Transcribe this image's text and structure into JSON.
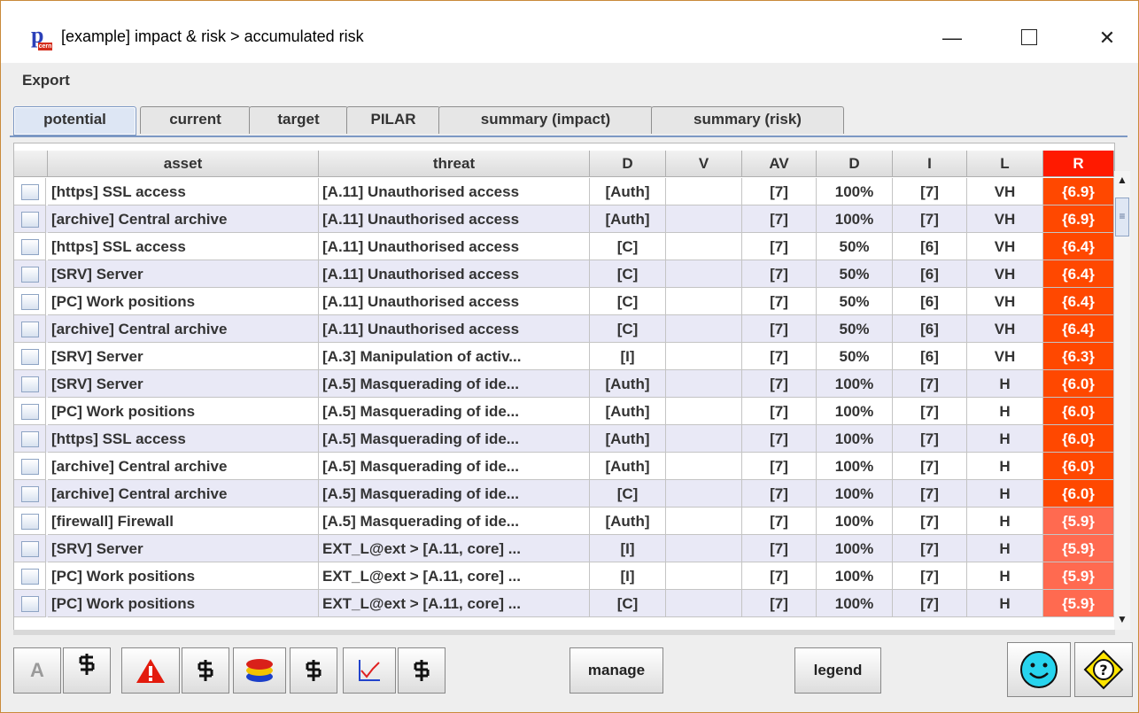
{
  "window": {
    "title": "[example] impact & risk > accumulated risk",
    "app_icon_letter": "p",
    "app_icon_tag": "cern",
    "minimize": "—",
    "close": "✕"
  },
  "menu": {
    "export": "Export"
  },
  "tabs": [
    "potential",
    "current",
    "target",
    "PILAR",
    "summary (impact)",
    "summary (risk)"
  ],
  "table": {
    "headers": [
      "asset",
      "threat",
      "D",
      "V",
      "AV",
      "D",
      "I",
      "L",
      "R"
    ],
    "rows": [
      {
        "asset": "[https] SSL access",
        "threat": "[A.11] Unauthorised access",
        "d": "[Auth]",
        "v": "",
        "av": "[7]",
        "d2": "100%",
        "i": "[7]",
        "l": "VH",
        "r": "{6.9}",
        "r_color": "#ff4800"
      },
      {
        "asset": "[archive] Central archive",
        "threat": "[A.11] Unauthorised access",
        "d": "[Auth]",
        "v": "",
        "av": "[7]",
        "d2": "100%",
        "i": "[7]",
        "l": "VH",
        "r": "{6.9}",
        "r_color": "#ff4800"
      },
      {
        "asset": "[https] SSL access",
        "threat": "[A.11] Unauthorised access",
        "d": "[C]",
        "v": "",
        "av": "[7]",
        "d2": "50%",
        "i": "[6]",
        "l": "VH",
        "r": "{6.4}",
        "r_color": "#ff4800"
      },
      {
        "asset": "[SRV] Server",
        "threat": "[A.11] Unauthorised access",
        "d": "[C]",
        "v": "",
        "av": "[7]",
        "d2": "50%",
        "i": "[6]",
        "l": "VH",
        "r": "{6.4}",
        "r_color": "#ff4800"
      },
      {
        "asset": "[PC] Work positions",
        "threat": "[A.11] Unauthorised access",
        "d": "[C]",
        "v": "",
        "av": "[7]",
        "d2": "50%",
        "i": "[6]",
        "l": "VH",
        "r": "{6.4}",
        "r_color": "#ff4800"
      },
      {
        "asset": "[archive] Central archive",
        "threat": "[A.11] Unauthorised access",
        "d": "[C]",
        "v": "",
        "av": "[7]",
        "d2": "50%",
        "i": "[6]",
        "l": "VH",
        "r": "{6.4}",
        "r_color": "#ff4800"
      },
      {
        "asset": "[SRV] Server",
        "threat": "[A.3] Manipulation of activ...",
        "d": "[I]",
        "v": "",
        "av": "[7]",
        "d2": "50%",
        "i": "[6]",
        "l": "VH",
        "r": "{6.3}",
        "r_color": "#ff4800"
      },
      {
        "asset": "[SRV] Server",
        "threat": "[A.5] Masquerading of ide...",
        "d": "[Auth]",
        "v": "",
        "av": "[7]",
        "d2": "100%",
        "i": "[7]",
        "l": "H",
        "r": "{6.0}",
        "r_color": "#ff4800"
      },
      {
        "asset": "[PC] Work positions",
        "threat": "[A.5] Masquerading of ide...",
        "d": "[Auth]",
        "v": "",
        "av": "[7]",
        "d2": "100%",
        "i": "[7]",
        "l": "H",
        "r": "{6.0}",
        "r_color": "#ff4800"
      },
      {
        "asset": "[https] SSL access",
        "threat": "[A.5] Masquerading of ide...",
        "d": "[Auth]",
        "v": "",
        "av": "[7]",
        "d2": "100%",
        "i": "[7]",
        "l": "H",
        "r": "{6.0}",
        "r_color": "#ff4800"
      },
      {
        "asset": "[archive] Central archive",
        "threat": "[A.5] Masquerading of ide...",
        "d": "[Auth]",
        "v": "",
        "av": "[7]",
        "d2": "100%",
        "i": "[7]",
        "l": "H",
        "r": "{6.0}",
        "r_color": "#ff4800"
      },
      {
        "asset": "[archive] Central archive",
        "threat": "[A.5] Masquerading of ide...",
        "d": "[C]",
        "v": "",
        "av": "[7]",
        "d2": "100%",
        "i": "[7]",
        "l": "H",
        "r": "{6.0}",
        "r_color": "#ff4800"
      },
      {
        "asset": "[firewall] Firewall",
        "threat": "[A.5] Masquerading of ide...",
        "d": "[Auth]",
        "v": "",
        "av": "[7]",
        "d2": "100%",
        "i": "[7]",
        "l": "H",
        "r": "{5.9}",
        "r_color": "#ff6a50"
      },
      {
        "asset": "[SRV] Server",
        "threat": "EXT_L@ext > [A.11, core] ...",
        "d": "[I]",
        "v": "",
        "av": "[7]",
        "d2": "100%",
        "i": "[7]",
        "l": "H",
        "r": "{5.9}",
        "r_color": "#ff6a50"
      },
      {
        "asset": "[PC] Work positions",
        "threat": "EXT_L@ext > [A.11, core] ...",
        "d": "[I]",
        "v": "",
        "av": "[7]",
        "d2": "100%",
        "i": "[7]",
        "l": "H",
        "r": "{5.9}",
        "r_color": "#ff6a50"
      },
      {
        "asset": "[PC] Work positions",
        "threat": "EXT_L@ext > [A.11, core] ...",
        "d": "[C]",
        "v": "",
        "av": "[7]",
        "d2": "100%",
        "i": "[7]",
        "l": "H",
        "r": "{5.9}",
        "r_color": "#ff6a50"
      }
    ]
  },
  "toolbar": {
    "a_label": "A",
    "filter_glyph": "钴",
    "warning_glyph": "!",
    "manage": "manage",
    "legend": "legend"
  },
  "colors": {
    "risk_header": "#ff1a00",
    "alt_row": "#e9e9f6",
    "tab_active": "#dde6f4"
  },
  "icons": {
    "db_icon": "database-stack-icon",
    "chart_icon": "line-chart-icon",
    "smiley_icon": "smiley-face-icon",
    "help_icon": "help-question-icon"
  }
}
